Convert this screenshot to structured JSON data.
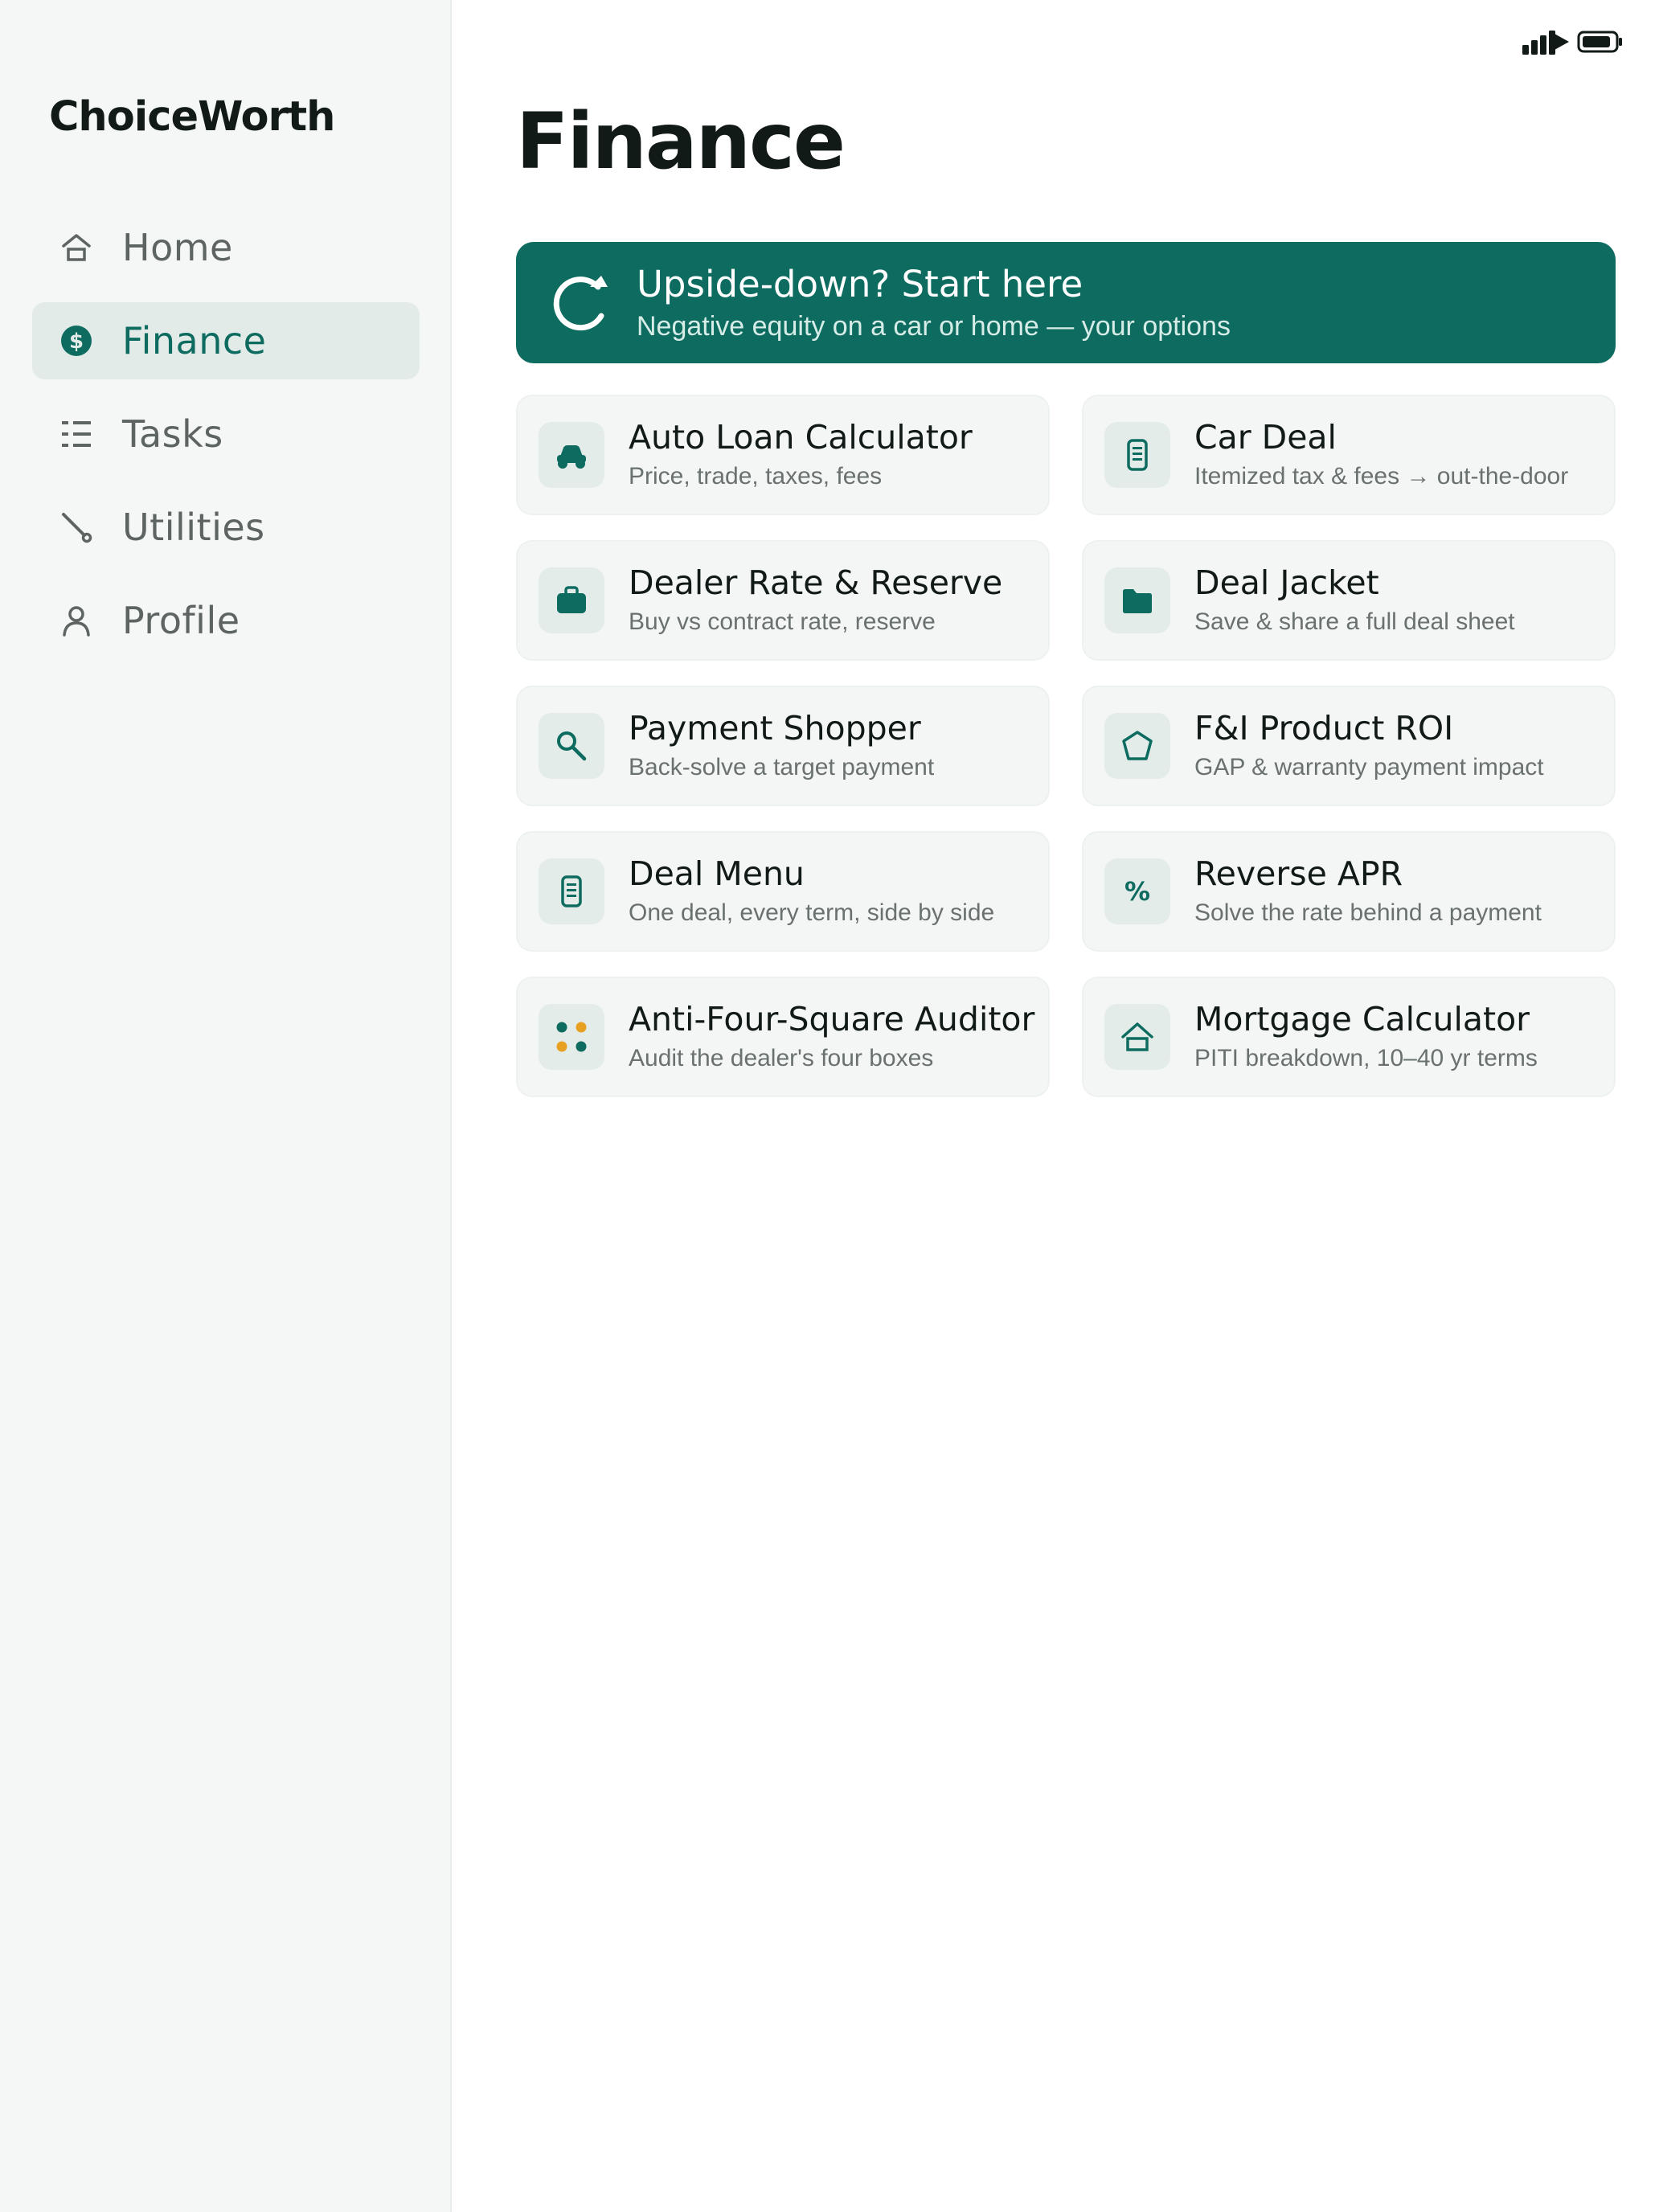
{
  "app": {
    "brand": "ChoiceWorth"
  },
  "sidebar": {
    "items": [
      {
        "label": "Home",
        "icon": "home-icon",
        "active": false
      },
      {
        "label": "Finance",
        "icon": "dollar-icon",
        "active": true
      },
      {
        "label": "Tasks",
        "icon": "tasks-icon",
        "active": false
      },
      {
        "label": "Utilities",
        "icon": "wrench-icon",
        "active": false
      },
      {
        "label": "Profile",
        "icon": "person-icon",
        "active": false
      }
    ]
  },
  "main": {
    "title": "Finance",
    "banner": {
      "title": "Upside-down? Start here",
      "subtitle": "Negative equity on a car or home — your options",
      "icon": "refresh-icon"
    },
    "cards": [
      {
        "title": "Auto Loan Calculator",
        "subtitle": "Price, trade, taxes, fees",
        "icon": "car-icon"
      },
      {
        "title": "Car Deal",
        "subtitle": "Itemized tax & fees → out-the-door",
        "icon": "receipt-icon"
      },
      {
        "title": "Dealer Rate & Reserve",
        "subtitle": "Buy vs contract rate, reserve",
        "icon": "briefcase-icon"
      },
      {
        "title": "Deal Jacket",
        "subtitle": "Save & share a full deal sheet",
        "icon": "folder-icon"
      },
      {
        "title": "Payment Shopper",
        "subtitle": "Back-solve a target payment",
        "icon": "search-icon"
      },
      {
        "title": "F&I Product ROI",
        "subtitle": "GAP & warranty payment impact",
        "icon": "shield-icon"
      },
      {
        "title": "Deal Menu",
        "subtitle": "One deal, every term, side by side",
        "icon": "receipt-icon"
      },
      {
        "title": "Reverse APR",
        "subtitle": "Solve the rate behind a payment",
        "icon": "percent-icon"
      },
      {
        "title": "Anti-Four-Square Auditor",
        "subtitle": "Audit the dealer's four boxes",
        "icon": "four-dots-icon"
      },
      {
        "title": "Mortgage Calculator",
        "subtitle": "PITI breakdown, 10–40 yr terms",
        "icon": "house-icon"
      }
    ]
  },
  "colors": {
    "accent": "#0e6b60",
    "amber": "#e8a020",
    "sidebar_bg": "#f5f7f6",
    "card_bg": "#f3f6f5"
  }
}
